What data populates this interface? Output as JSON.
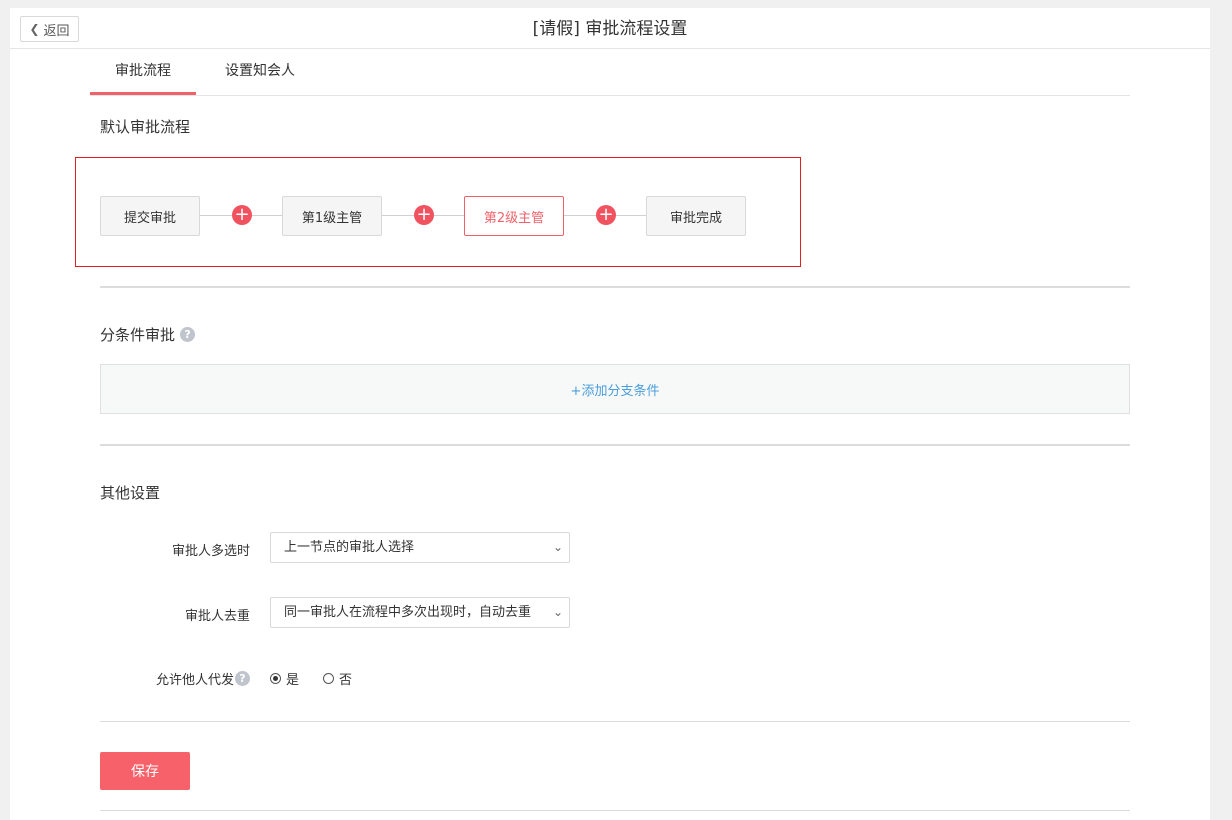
{
  "header": {
    "back_label": "返回",
    "title": "[请假] 审批流程设置"
  },
  "tabs": [
    {
      "label": "审批流程",
      "active": true
    },
    {
      "label": "设置知会人",
      "active": false
    }
  ],
  "default_flow": {
    "title": "默认审批流程",
    "nodes": [
      {
        "label": "提交审批",
        "active": false
      },
      {
        "label": "第1级主管",
        "active": false
      },
      {
        "label": "第2级主管",
        "active": true
      },
      {
        "label": "审批完成",
        "active": false
      }
    ],
    "add_icon": "+"
  },
  "conditional": {
    "title": "分条件审批",
    "help_icon": "?",
    "add_branch_label": "+添加分支条件"
  },
  "other_settings": {
    "title": "其他设置",
    "multi_approver": {
      "label": "审批人多选时",
      "value": "上一节点的审批人选择"
    },
    "dedupe": {
      "label": "审批人去重",
      "value": "同一审批人在流程中多次出现时，自动去重"
    },
    "allow_proxy": {
      "label": "允许他人代发",
      "help_icon": "?",
      "options": [
        {
          "label": "是",
          "checked": true
        },
        {
          "label": "否",
          "checked": false
        }
      ]
    }
  },
  "save_label": "保存",
  "colors": {
    "accent": "#f0626a",
    "link": "#4a9edb",
    "highlight_border": "#e02020"
  }
}
